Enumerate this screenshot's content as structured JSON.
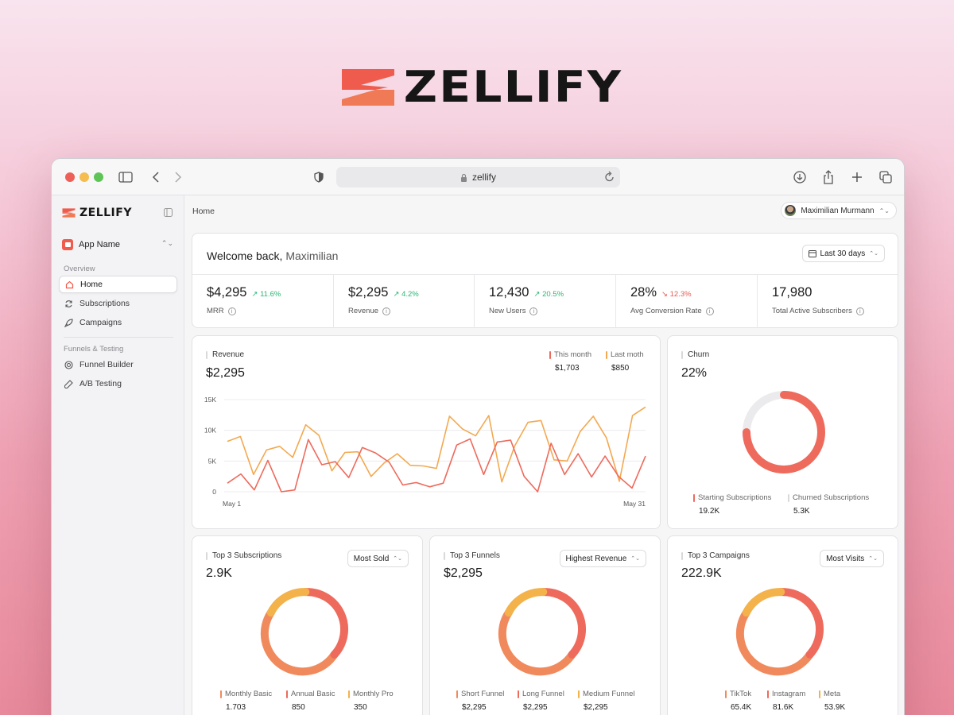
{
  "brand": {
    "wordmark": "ZELLIFY",
    "logo_colors": [
      "#ef5b4c",
      "#f08a5d"
    ]
  },
  "browser": {
    "url": "zellify",
    "icons": [
      "sidebar-icon",
      "back-icon",
      "forward-icon",
      "shield-icon",
      "lock-icon",
      "reload-icon",
      "download-icon",
      "share-icon",
      "new-tab-icon",
      "tabs-icon"
    ]
  },
  "sidebar": {
    "logo": "ZELLIFY",
    "app_selector": "App Name",
    "section_overview": "Overview",
    "section_funnels": "Funnels & Testing",
    "items": [
      {
        "label": "Home",
        "icon": "home-icon",
        "active": true
      },
      {
        "label": "Subscriptions",
        "icon": "refresh-icon"
      },
      {
        "label": "Campaigns",
        "icon": "rocket-icon"
      },
      {
        "label": "Funnel Builder",
        "icon": "target-icon"
      },
      {
        "label": "A/B Testing",
        "icon": "flask-icon"
      }
    ]
  },
  "header": {
    "breadcrumb": "Home",
    "user": "Maximilian Murmann"
  },
  "welcome": {
    "greeting": "Welcome back,",
    "name": "Maximilian",
    "range": "Last 30 days"
  },
  "stats": [
    {
      "value": "$4,295",
      "delta": "11.6%",
      "dir": "up",
      "label": "MRR"
    },
    {
      "value": "$2,295",
      "delta": "4.2%",
      "dir": "up",
      "label": "Revenue"
    },
    {
      "value": "12,430",
      "delta": "20.5%",
      "dir": "up",
      "label": "New Users"
    },
    {
      "value": "28%",
      "delta": "12.3%",
      "dir": "down",
      "label": "Avg Conversion Rate"
    },
    {
      "value": "17,980",
      "delta": "",
      "dir": "",
      "label": "Total Active Subscribers"
    }
  ],
  "revenue": {
    "title": "Revenue",
    "value": "$2,295",
    "legend": [
      {
        "label": "This month",
        "value": "$1,703",
        "color": "#ee6a5c"
      },
      {
        "label": "Last moth",
        "value": "$850",
        "color": "#f3a950"
      }
    ]
  },
  "churn": {
    "title": "Churn",
    "value": "22%",
    "legend": [
      {
        "label": "Starting Subscriptions",
        "value": "19.2K",
        "color": "#ee6a5c"
      },
      {
        "label": "Churned Subscriptions",
        "value": "5.3K",
        "color": "#d9d9dc"
      }
    ]
  },
  "top_subs": {
    "title": "Top 3 Subscriptions",
    "value": "2.9K",
    "filter": "Most Sold",
    "legend": [
      {
        "label": "Monthly Basic",
        "value": "1.703",
        "color": "#f08a5d"
      },
      {
        "label": "Annual Basic",
        "value": "850",
        "color": "#ee6a5c"
      },
      {
        "label": "Monthly Pro",
        "value": "350",
        "color": "#f3b24a"
      }
    ]
  },
  "top_funnels": {
    "title": "Top 3 Funnels",
    "value": "$2,295",
    "filter": "Highest Revenue",
    "legend": [
      {
        "label": "Short Funnel",
        "value": "$2,295",
        "color": "#f08a5d"
      },
      {
        "label": "Long Funnel",
        "value": "$2,295",
        "color": "#ee6a5c"
      },
      {
        "label": "Medium Funnel",
        "value": "$2,295",
        "color": "#f3b24a"
      }
    ]
  },
  "top_campaigns": {
    "title": "Top 3 Campaigns",
    "value": "222.9K",
    "filter": "Most Visits",
    "legend": [
      {
        "label": "TikTok",
        "value": "65.4K",
        "color": "#f08a5d"
      },
      {
        "label": "Instagram",
        "value": "81.6K",
        "color": "#ee6a5c"
      },
      {
        "label": "Meta",
        "value": "53.9K",
        "color": "#f3b24a"
      }
    ]
  },
  "chart_data": [
    {
      "type": "line",
      "x_labels": [
        "May 1",
        "May 31"
      ],
      "ylabels": [
        "15K",
        "10K",
        "5K",
        "0"
      ],
      "ylim": [
        0,
        15000
      ],
      "grid": true,
      "series": [
        {
          "name": "Last moth",
          "color": "#f3a950",
          "values": [
            8200,
            9000,
            2800,
            6800,
            7400,
            5600,
            10900,
            9200,
            3400,
            6400,
            6500,
            2500,
            4700,
            6200,
            4300,
            4200,
            3800,
            12300,
            10200,
            9100,
            12400,
            1600,
            7500,
            11300,
            11600,
            5200,
            5000,
            9800,
            12300,
            8800,
            1700,
            12400,
            13800
          ]
        },
        {
          "name": "This month",
          "color": "#ee6a5c",
          "values": [
            1400,
            2900,
            300,
            5100,
            0,
            300,
            8500,
            4400,
            4900,
            2300,
            7200,
            6300,
            4800,
            1100,
            1500,
            800,
            1400,
            7600,
            8600,
            2800,
            8100,
            8400,
            2500,
            0,
            7900,
            2800,
            6200,
            2400,
            5800,
            2500,
            600,
            5800
          ]
        }
      ]
    },
    {
      "type": "pie",
      "title": "Churn",
      "values": [
        {
          "label": "Starting Subscriptions",
          "value": 78
        },
        {
          "label": "Churned Subscriptions",
          "value": 22
        }
      ]
    }
  ]
}
